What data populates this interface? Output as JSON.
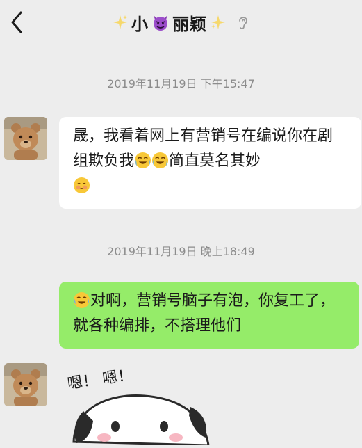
{
  "header": {
    "title_left": "小",
    "title_right": "丽颖"
  },
  "messages": [
    {
      "timestamp": "2019年11月19日 下午15:47",
      "text_part1": "晟，我看着网上有营销号在编说你在剧组欺负我",
      "text_part2": "简直莫名其妙"
    },
    {
      "timestamp": "2019年11月19日 晚上18:49",
      "text_part1": "对啊，营销号脑子有泡，你复工了，就各种编排，不搭理他们"
    }
  ],
  "sticker": {
    "caption": "嗯！ 嗯！"
  },
  "colors": {
    "background": "#ededed",
    "bubble_right": "#95ec69",
    "bubble_left": "#ffffff"
  },
  "icons": [
    "back-arrow-icon",
    "sparkle-icon",
    "devil-emoji-icon",
    "ear-icon",
    "crying-laughing-emoji-icon",
    "flushed-emoji-icon",
    "laughing-tears-emoji-icon"
  ]
}
